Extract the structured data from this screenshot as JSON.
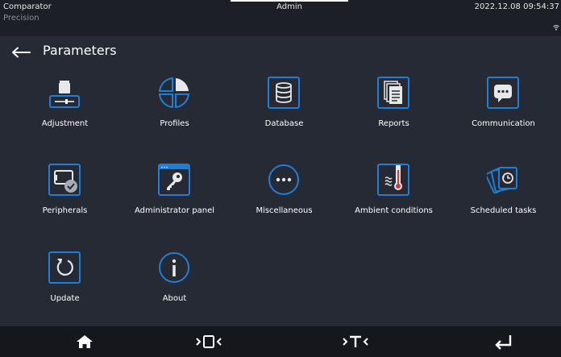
{
  "status_bar": {
    "app_name": "Comparator",
    "mode": "Precision",
    "user": "Admin",
    "datetime": "2022.12.08 09:54:37"
  },
  "header": {
    "title": "Parameters"
  },
  "menu": [
    {
      "label": "Adjustment",
      "icon": "adjustment-icon"
    },
    {
      "label": "Profiles",
      "icon": "profiles-icon"
    },
    {
      "label": "Database",
      "icon": "database-icon"
    },
    {
      "label": "Reports",
      "icon": "reports-icon"
    },
    {
      "label": "Communication",
      "icon": "communication-icon"
    },
    {
      "label": "Peripherals",
      "icon": "peripherals-icon"
    },
    {
      "label": "Administrator panel",
      "icon": "administrator-key-icon"
    },
    {
      "label": "Miscellaneous",
      "icon": "miscellaneous-icon"
    },
    {
      "label": "Ambient conditions",
      "icon": "ambient-conditions-icon"
    },
    {
      "label": "Scheduled tasks",
      "icon": "scheduled-tasks-icon"
    },
    {
      "label": "Update",
      "icon": "update-icon"
    },
    {
      "label": "About",
      "icon": "about-icon"
    }
  ],
  "bottom_bar": {
    "buttons": [
      "home-icon",
      "zero-icon",
      "tare-icon",
      "enter-icon"
    ]
  },
  "colors": {
    "accent": "#1f7fd8",
    "background": "#252a34",
    "top_bar": "#1c1f26",
    "bottom_bar": "#15171c"
  }
}
